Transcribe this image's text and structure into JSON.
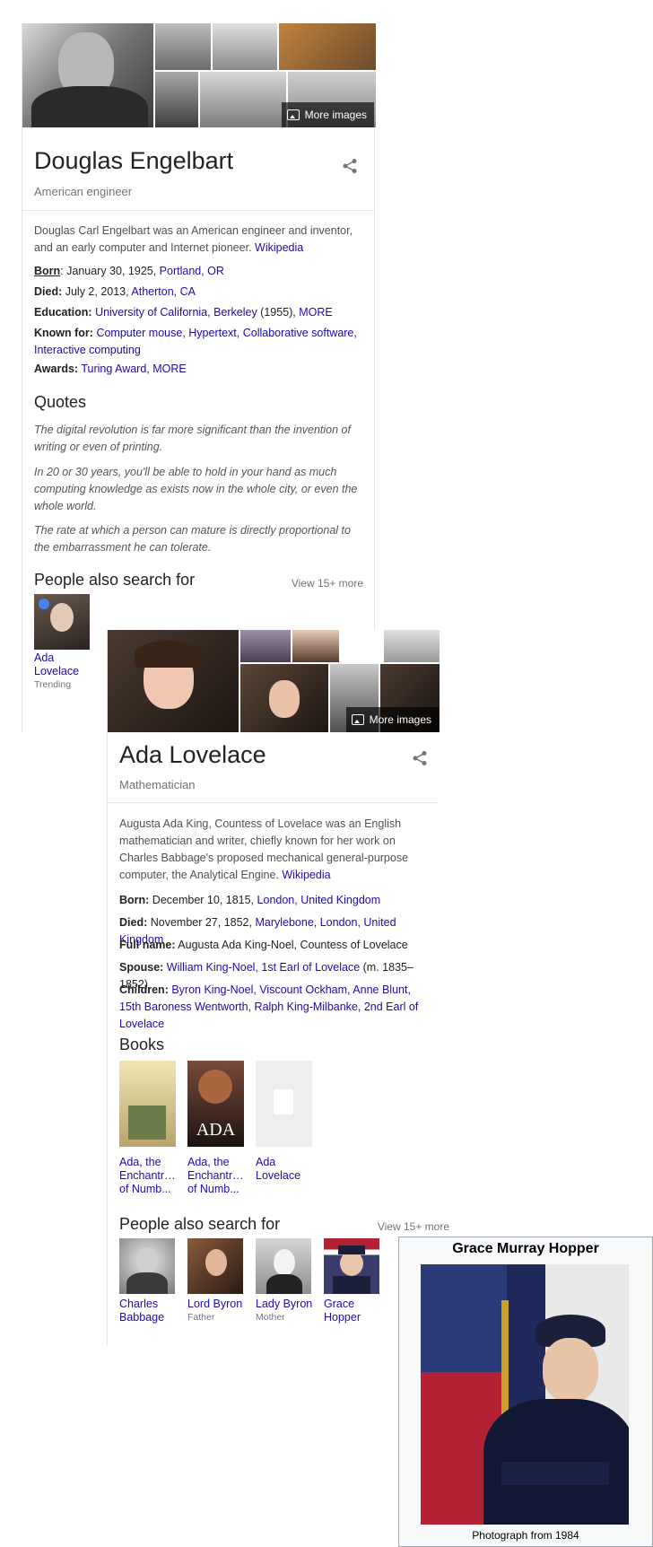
{
  "panel1": {
    "more_images": "More images",
    "title": "Douglas Engelbart",
    "subtitle": "American engineer",
    "description": "Douglas Carl Engelbart was an American engineer and inventor, and an early computer and Internet pioneer.",
    "description_link": "Wikipedia",
    "facts": {
      "born_label": "Born",
      "born_value": ": January 30, 1925, ",
      "born_link": "Portland, OR",
      "died_label": "Died:",
      "died_value": " July 2, 2013, ",
      "died_link": "Atherton, CA",
      "education_label": "Education:",
      "education_link": "University of California, Berkeley",
      "education_value": " (1955), ",
      "education_more": "MORE",
      "known_label": "Known for:",
      "known_links": "Computer mouse, Hypertext, Collaborative software, Interactive computing",
      "awards_label": "Awards:",
      "awards_link": "Turing Award, MORE"
    },
    "quotes_heading": "Quotes",
    "quotes": [
      "The digital revolution is far more significant than the invention of writing or even of printing.",
      "In 20 or 30 years, you'll be able to hold in your hand as much computing knowledge as exists now in the whole city, or even the whole world.",
      "The rate at which a person can mature is directly proportional to the embarrassment he can tolerate."
    ],
    "people_heading": "People also search for",
    "people_more": "View 15+ more",
    "people": [
      {
        "name": "Ada Lovelace",
        "sub": "Trending"
      }
    ]
  },
  "panel2": {
    "more_images": "More images",
    "title": "Ada Lovelace",
    "subtitle": "Mathematician",
    "description": "Augusta Ada King, Countess of Lovelace was an English mathematician and writer, chiefly known for her work on Charles Babbage's proposed mechanical general-purpose computer, the Analytical Engine.",
    "description_link": "Wikipedia",
    "facts": {
      "born_label": "Born:",
      "born_value": " December 10, 1815, ",
      "born_link": "London, United Kingdom",
      "died_label": "Died:",
      "died_value": " November 27, 1852, ",
      "died_link": "Marylebone, London, United Kingdom",
      "fullname_label": "Full name:",
      "fullname_value": " Augusta Ada King-Noel, Countess of Lovelace",
      "spouse_label": "Spouse:",
      "spouse_link": "William King-Noel, 1st Earl of Lovelace",
      "spouse_value": " (m. 1835–1852)",
      "children_label": "Children:",
      "children_links": "Byron King-Noel, Viscount Ockham, Anne Blunt, 15th Baroness Wentworth, Ralph King-Milbanke, 2nd Earl of Lovelace"
    },
    "books_heading": "Books",
    "books": [
      {
        "title": "Ada, the Enchantr… of Numb..."
      },
      {
        "title": "Ada, the Enchantr… of Numb...",
        "cover_text": "ADA"
      },
      {
        "title": "Ada Lovelace"
      }
    ],
    "people_heading": "People also search for",
    "people_more": "View 15+ more",
    "people": [
      {
        "name": "Charles Babbage",
        "sub": ""
      },
      {
        "name": "Lord Byron",
        "sub": "Father"
      },
      {
        "name": "Lady Byron",
        "sub": "Mother"
      },
      {
        "name": "Grace Hopper",
        "sub": ""
      }
    ]
  },
  "frame": {
    "title": "Grace Murray Hopper",
    "caption": "Photograph from 1984"
  },
  "colors": {
    "link": "#1a0dab",
    "muted": "#70757a",
    "border": "#e6e6e6"
  }
}
